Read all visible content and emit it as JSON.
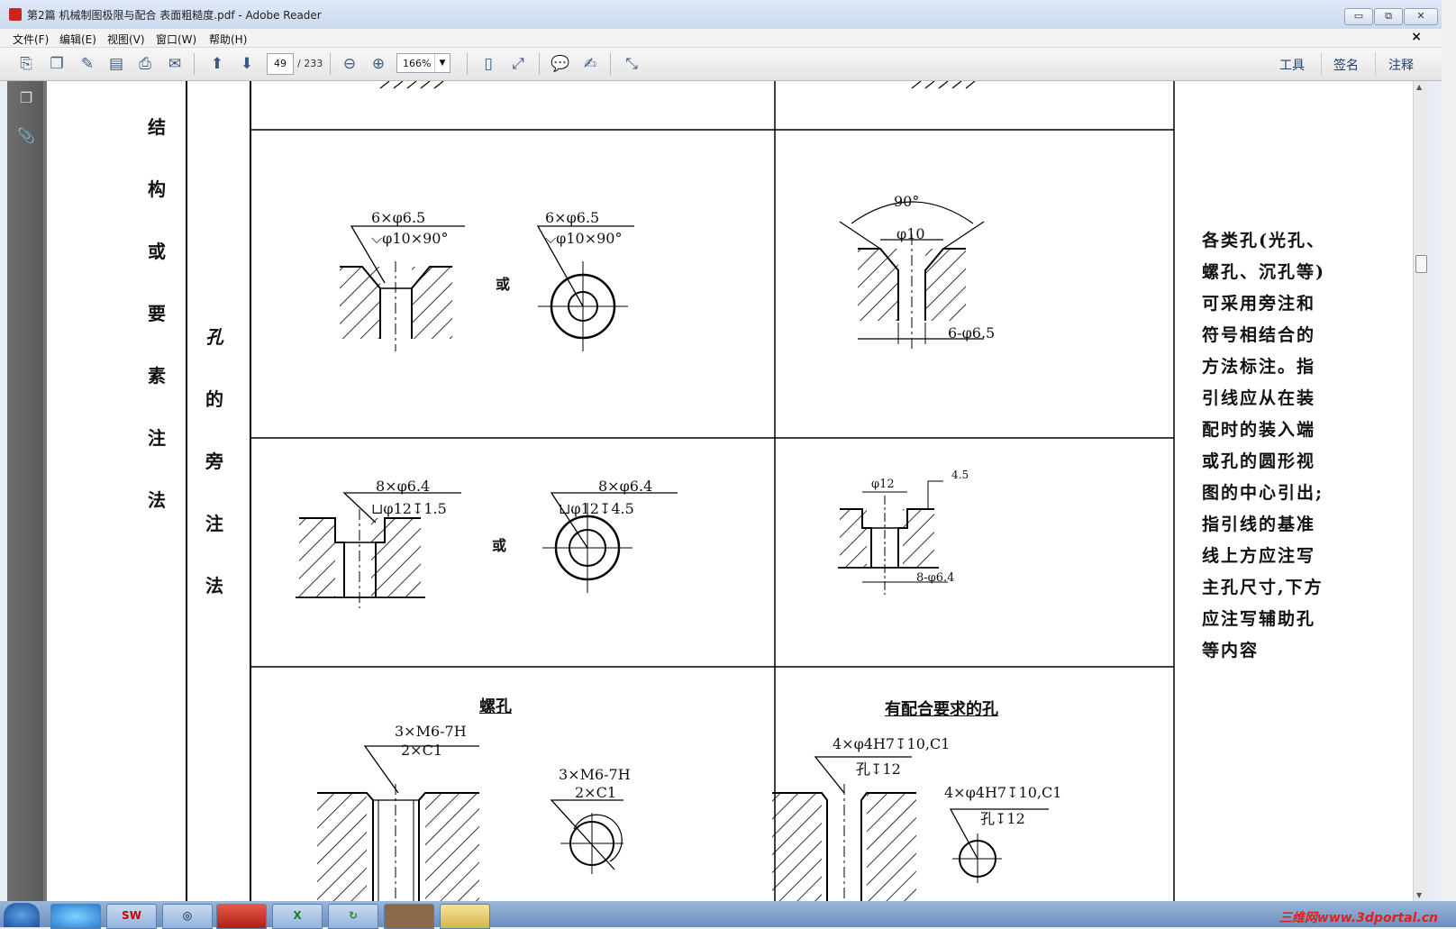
{
  "window": {
    "title": "第2篇 机械制图极限与配合 表面粗糙度.pdf - Adobe Reader",
    "min_label": "▭",
    "restore_label": "⧉",
    "close_label": "✕"
  },
  "menu": {
    "items": [
      "文件(F)",
      "编辑(E)",
      "视图(V)",
      "窗口(W)",
      "帮助(H)"
    ],
    "doc_close": "×"
  },
  "toolbar": {
    "page_current": "49",
    "page_total": "/ 233",
    "zoom": "166%",
    "right": [
      "工具",
      "签名",
      "注释"
    ]
  },
  "document": {
    "col1_text": [
      "结",
      "构",
      "或",
      "要",
      "素",
      "注",
      "法"
    ],
    "col2_text": [
      "孔",
      "的",
      "旁",
      "注",
      "法"
    ],
    "row1": {
      "left_label1": "6×φ6.5",
      "left_label2": "⌵φ10×90°",
      "or": "或",
      "mid_label1": "6×φ6.5",
      "mid_label2": "⌵φ10×90°",
      "right_angle": "90°",
      "right_dia": "φ10",
      "right_hole": "6-φ6.5"
    },
    "row2": {
      "left_label1": "8×φ6.4",
      "left_label2": "⊔φ12↧1.5",
      "or": "或",
      "mid_label1": "8×φ6.4",
      "mid_label2": "⊔φ12↧4.5",
      "right_dia": "φ12",
      "right_depth": "4.5",
      "right_hole": "8-φ6.4"
    },
    "row3": {
      "left_title": "螺孔",
      "left_label1": "3×M6-7H",
      "left_label2": "2×C1",
      "mid_label1": "3×M6-7H",
      "mid_label2": "2×C1",
      "right_title": "有配合要求的孔",
      "right_label1": "4×φ4H7↧10,C1",
      "right_label2": "孔↧12",
      "right_label3": "4×φ4H7↧10,C1",
      "right_label4": "孔↧12"
    },
    "description": "各类孔(光孔、螺孔、沉孔等)可采用旁注和符号相结合的方法标注。指引线应从在装配时的装入端或孔的圆形视图的中心引出;指引线的基准线上方应注写主孔尺寸,下方应注写辅助孔等内容"
  },
  "taskbar": {
    "watermark": "三维网www.3dportal.cn"
  }
}
